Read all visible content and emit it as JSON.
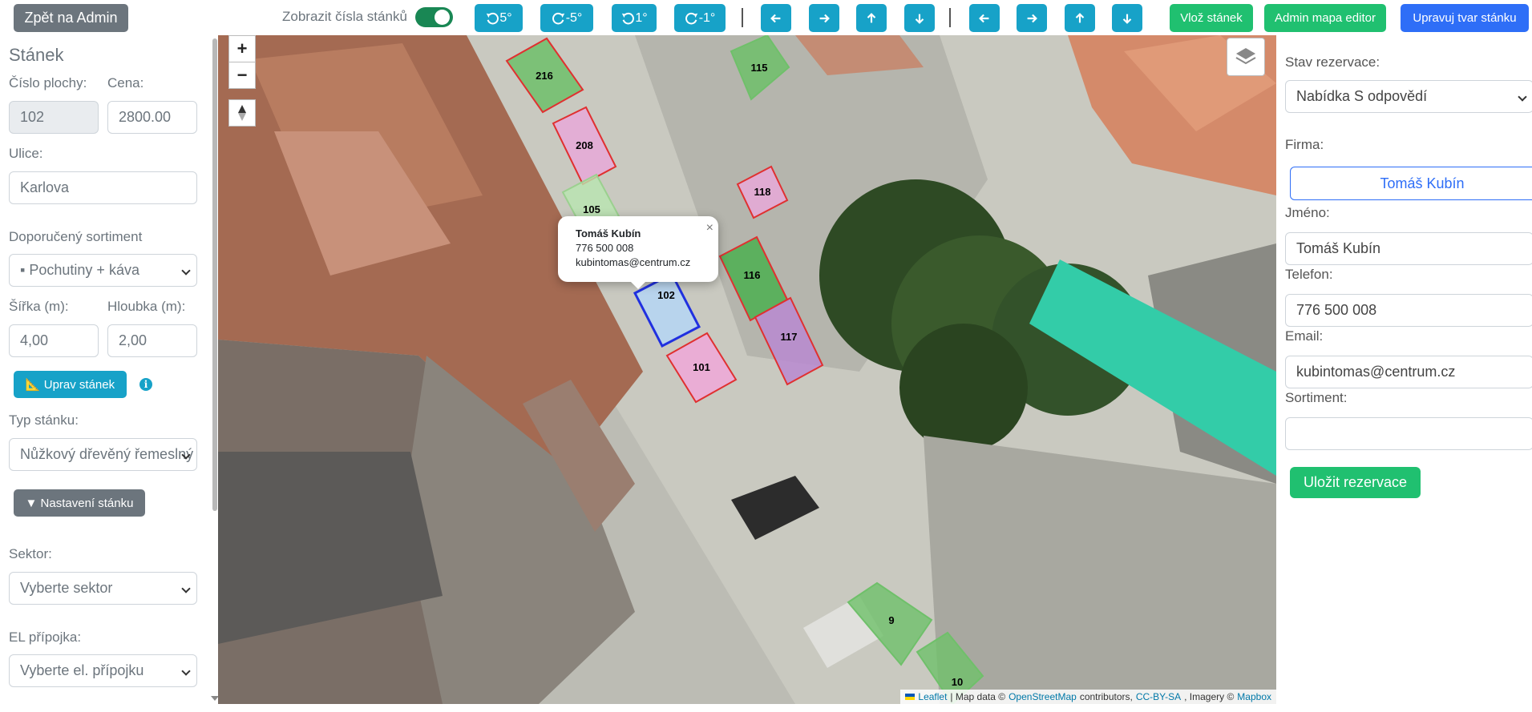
{
  "toolbar": {
    "back_label": "Zpět na Admin",
    "toggle_label": "Zobrazit čísla stánků",
    "toggle_on": true,
    "rotate_buttons": [
      "5°",
      "-5°",
      "1°",
      "-1°"
    ],
    "insert_label": "Vlož stánek",
    "map_editor_label": "Admin mapa editor",
    "edit_shape_label": "Upravuj tvar stánku"
  },
  "left": {
    "title": "Stánek",
    "plot_number_label": "Číslo plochy:",
    "plot_number_value": "102",
    "price_label": "Cena:",
    "price_value": "2800.00",
    "street_label": "Ulice:",
    "street_value": "Karlova",
    "assortment_label": "Doporučený sortiment",
    "assortment_value": "▪ Pochutiny + káva",
    "width_label": "Šířka (m):",
    "width_value": "4,00",
    "depth_label": "Hloubka (m):",
    "depth_value": "2,00",
    "edit_stall_label": "📐 Uprav stánek",
    "type_label": "Typ stánku:",
    "type_value": "Nůžkový dřevěný řemeslný",
    "settings_label": "▼ Nastavení stánku",
    "sector_label": "Sektor:",
    "sector_value": "Vyberte sektor",
    "el_label": "EL přípojka:",
    "el_value": "Vyberte el. přípojku"
  },
  "map": {
    "stalls": [
      {
        "id": "216",
        "label": "216",
        "fill": "#6fc06a",
        "stroke": "#e03030"
      },
      {
        "id": "208",
        "label": "208",
        "fill": "#e8a9d8",
        "stroke": "#e03030"
      },
      {
        "id": "115",
        "label": "115",
        "fill": "#6fc06a",
        "stroke": "#6fc06a"
      },
      {
        "id": "105",
        "label": "105",
        "fill": "#b9e6b0",
        "stroke": "#9bd08f"
      },
      {
        "id": "118",
        "label": "118",
        "fill": "#e8a9d8",
        "stroke": "#e03030"
      },
      {
        "id": "116",
        "label": "116",
        "fill": "#4caf50",
        "stroke": "#e03030"
      },
      {
        "id": "117",
        "label": "117",
        "fill": "#b88ad0",
        "stroke": "#e03030"
      },
      {
        "id": "102",
        "label": "102",
        "fill": "#b5d6f5",
        "stroke": "#2030e0"
      },
      {
        "id": "101",
        "label": "101",
        "fill": "#f0a8d8",
        "stroke": "#e03030"
      },
      {
        "id": "9",
        "label": "9",
        "fill": "#6fc06a",
        "stroke": "#6fc06a"
      },
      {
        "id": "10",
        "label": "10",
        "fill": "#6fc06a",
        "stroke": "#6fc06a"
      }
    ],
    "popup": {
      "name": "Tomáš Kubín",
      "phone": "776 500 008",
      "email": "kubintomas@centrum.cz",
      "close": "×"
    },
    "attribution": {
      "leaflet": "Leaflet",
      "map_data": "| Map data ©",
      "osm": "OpenStreetMap",
      "contributors": "contributors,",
      "license": "CC-BY-SA",
      "imagery": ", Imagery ©",
      "mapbox": "Mapbox"
    },
    "zoom_in": "+",
    "zoom_out": "−"
  },
  "right": {
    "status_label": "Stav rezervace:",
    "status_value": "Nabídka S odpovědí",
    "firm_label": "Firma:",
    "firm_button": "Tomáš Kubín",
    "name_label": "Jméno:",
    "name_value": "Tomáš Kubín",
    "phone_label": "Telefon:",
    "phone_value": "776 500 008",
    "email_label": "Email:",
    "email_value": "kubintomas@centrum.cz",
    "sortiment_label": "Sortiment:",
    "sortiment_value": "",
    "save_label": "Uložit rezervace"
  }
}
